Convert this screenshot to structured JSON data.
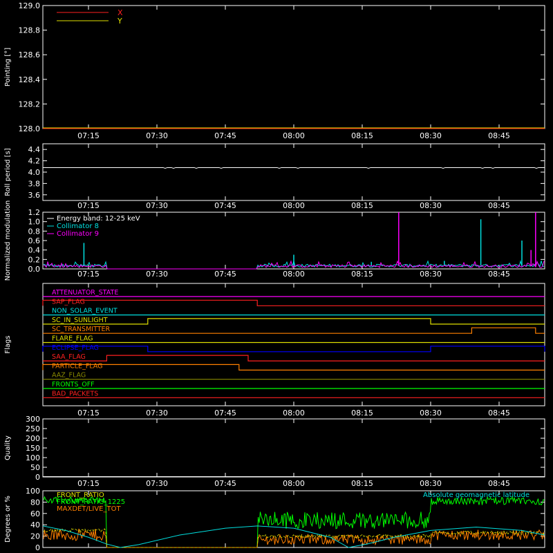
{
  "time_ticks": [
    "07:15",
    "07:30",
    "07:45",
    "08:00",
    "08:15",
    "08:30",
    "08:45"
  ],
  "colors": {
    "background": "#000000",
    "axes": "#ffffff",
    "red": "#ff2020",
    "yellow": "#e0e000",
    "cyan": "#00e0e0",
    "magenta": "#ff00ff",
    "green": "#00ff00",
    "orange": "#ff8000",
    "blue": "#0000ff",
    "olive": "#8a8a00"
  },
  "chart_data": [
    {
      "type": "line",
      "ylabel": "Pointing [°]",
      "ylim": [
        128.0,
        129.0
      ],
      "yticks": [
        "129.0",
        "128.8",
        "128.6",
        "128.4",
        "128.2",
        "128.0"
      ],
      "legend": [
        "X",
        "Y"
      ],
      "series": [
        {
          "name": "X",
          "color": "red",
          "x": [
            "07:05",
            "08:55"
          ],
          "values": [
            128.0,
            128.0
          ]
        },
        {
          "name": "Y",
          "color": "yellow",
          "x": [
            "07:05",
            "08:55"
          ],
          "values": [
            128.0,
            128.0
          ]
        }
      ]
    },
    {
      "type": "line",
      "ylabel": "Roll period [s]",
      "ylim": [
        3.5,
        4.5
      ],
      "yticks": [
        "4.4",
        "4.2",
        "4.0",
        "3.8",
        "3.6"
      ],
      "series": [
        {
          "color": "white",
          "x": [
            "07:05",
            "08:55"
          ],
          "values": [
            4.08,
            4.08
          ]
        }
      ]
    },
    {
      "type": "line",
      "ylabel": "Normalized modulation",
      "ylim": [
        0.0,
        1.2
      ],
      "yticks": [
        "1.2",
        "1.0",
        "0.8",
        "0.6",
        "0.4",
        "0.2",
        "0.0"
      ],
      "legend": [
        "Energy band: 12-25 keV",
        "Collimator 8",
        "Collimator 9"
      ],
      "gaps": [
        [
          "07:19",
          "07:52"
        ]
      ],
      "series": [
        {
          "name": "Collimator 8",
          "color": "cyan",
          "baseline": 0.07,
          "spikes": [
            [
              "07:14",
              0.55
            ],
            [
              "08:00",
              0.3
            ],
            [
              "08:17",
              0.15
            ],
            [
              "08:33",
              0.17
            ],
            [
              "08:41",
              1.05
            ],
            [
              "08:50",
              0.6
            ]
          ]
        },
        {
          "name": "Collimator 9",
          "color": "magenta",
          "baseline": 0.06,
          "spikes": [
            [
              "08:23",
              1.2
            ],
            [
              "08:53",
              1.2
            ],
            [
              "08:52",
              0.4
            ]
          ]
        }
      ]
    },
    {
      "type": "timeline",
      "ylabel": "Flags",
      "flags": [
        {
          "name": "ATTENUATOR_STATE",
          "color": "magenta",
          "high": []
        },
        {
          "name": "SAP_FLAG",
          "color": "red",
          "high": [
            [
              "07:05",
              "07:52"
            ]
          ]
        },
        {
          "name": "NON_SOLAR_EVENT",
          "color": "cyan",
          "high": []
        },
        {
          "name": "SC_IN_SUNLIGHT",
          "color": "yellow",
          "high": [
            [
              "07:28",
              "08:30"
            ]
          ]
        },
        {
          "name": "SC_TRANSMITTER",
          "color": "orange",
          "high": [
            [
              "08:39",
              "08:53"
            ]
          ]
        },
        {
          "name": "FLARE_FLAG",
          "color": "yellow",
          "high": []
        },
        {
          "name": "ECLIPSE_FLAG",
          "color": "blue",
          "high": [
            [
              "07:05",
              "07:28"
            ],
            [
              "08:30",
              "08:55"
            ]
          ]
        },
        {
          "name": "SAA_FLAG",
          "color": "red",
          "high": [
            [
              "07:19",
              "07:50"
            ]
          ]
        },
        {
          "name": "PARTICLE_FLAG",
          "color": "orange",
          "high": [
            [
              "07:05",
              "07:48"
            ]
          ]
        },
        {
          "name": "AAZ_FLAG",
          "color": "olive",
          "high": []
        },
        {
          "name": "FRONTS_OFF",
          "color": "green",
          "high": []
        },
        {
          "name": "BAD_PACKETS",
          "color": "red",
          "high": []
        }
      ]
    },
    {
      "type": "line",
      "ylabel": "Quality",
      "ylim": [
        0,
        300
      ],
      "yticks": [
        "300",
        "250",
        "200",
        "150",
        "100",
        "50",
        "0"
      ],
      "series": [
        {
          "color": "white",
          "x": [
            "07:05",
            "08:55"
          ],
          "values": [
            0,
            0
          ]
        }
      ]
    },
    {
      "type": "line",
      "ylabel": "Degrees or %",
      "ylim": [
        0,
        100
      ],
      "yticks": [
        "100",
        "80",
        "60",
        "40",
        "20",
        "0"
      ],
      "legend": [
        "FRONT_RATIO",
        "FRONT_RATIO_1225",
        "MAXDET/LIVE_TOT",
        "Absolute geomagnetic latitude"
      ],
      "series": [
        {
          "name": "FRONT_RATIO",
          "color": "yellow"
        },
        {
          "name": "FRONT_RATIO_1225",
          "color": "green"
        },
        {
          "name": "MAXDET/LIVE_TOT",
          "color": "orange"
        },
        {
          "name": "Absolute geomagnetic latitude",
          "color": "cyan",
          "x": [
            "07:05",
            "07:10",
            "07:15",
            "07:19",
            "07:22",
            "07:26",
            "07:35",
            "07:45",
            "07:52",
            "08:00",
            "08:08",
            "08:12",
            "08:16",
            "08:22",
            "08:30",
            "08:40",
            "08:50",
            "08:55"
          ],
          "values": [
            38,
            30,
            18,
            6,
            0,
            5,
            22,
            34,
            38,
            34,
            18,
            0,
            6,
            18,
            30,
            36,
            30,
            22
          ]
        }
      ]
    }
  ]
}
